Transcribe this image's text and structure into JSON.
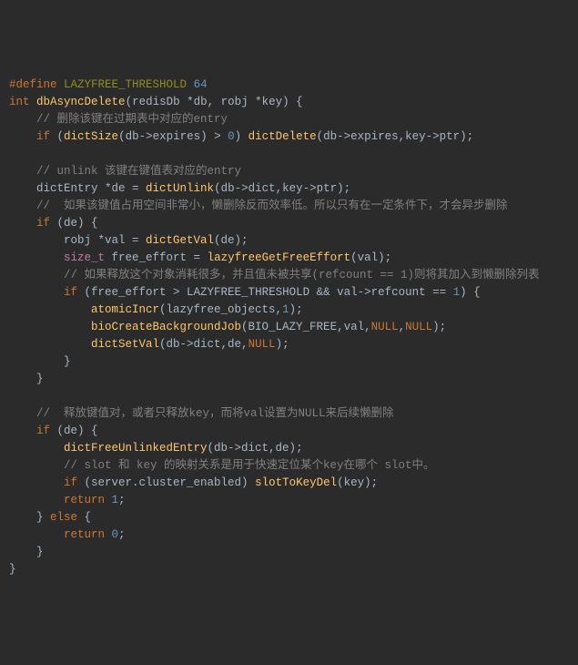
{
  "code": {
    "l01_define": "#define",
    "l01_macro": "LAZYFREE_THRESHOLD",
    "l01_val": "64",
    "l02_int": "int",
    "l02_fn": "dbAsyncDelete",
    "l02_sig": "(redisDb *db, robj *key) {",
    "l03": "// 删除该键在过期表中对应的entry",
    "l04_if": "if",
    "l04_a": " (",
    "l04_fn": "dictSize",
    "l04_b": "(db->expires) > ",
    "l04_zero": "0",
    "l04_c": ") ",
    "l04_fn2": "dictDelete",
    "l04_d": "(db->expires,key->ptr);",
    "l06": "// unlink 该键在键值表对应的entry",
    "l07_a": "dictEntry *de = ",
    "l07_fn": "dictUnlink",
    "l07_b": "(db->dict,key->ptr);",
    "l08": "//  如果该键值占用空间非常小，懒删除反而效率低。所以只有在一定条件下，才会异步删除",
    "l09_if": "if",
    "l09_a": " (de) {",
    "l10_a": "robj *val = ",
    "l10_fn": "dictGetVal",
    "l10_b": "(de);",
    "l11_type": "size_t",
    "l11_a": " free_effort = ",
    "l11_fn": "lazyfreeGetFreeEffort",
    "l11_b": "(val);",
    "l12": "// 如果释放这个对象消耗很多，并且值未被共享(refcount == 1)则将其加入到懒删除列表",
    "l13_if": "if",
    "l13_a": " (free_effort > LAZYFREE_THRESHOLD && val->refcount == ",
    "l13_one": "1",
    "l13_b": ") {",
    "l14_fn": "atomicIncr",
    "l14_a": "(lazyfree_objects,",
    "l14_one": "1",
    "l14_b": ");",
    "l15_fn": "bioCreateBackgroundJob",
    "l15_a": "(BIO_LAZY_FREE,val,",
    "l15_null1": "NULL",
    "l15_c": ",",
    "l15_null2": "NULL",
    "l15_b": ");",
    "l16_fn": "dictSetVal",
    "l16_a": "(db->dict,de,",
    "l16_null": "NULL",
    "l16_b": ");",
    "l17": "}",
    "l18": "}",
    "l20": "//  释放键值对，或者只释放key，而将val设置为NULL来后续懒删除",
    "l21_if": "if",
    "l21_a": " (de) {",
    "l22_fn": "dictFreeUnlinkedEntry",
    "l22_a": "(db->dict,de);",
    "l23": "// slot 和 key 的映射关系是用于快速定位某个key在哪个 slot中。",
    "l24_if": "if",
    "l24_a": " (server.cluster_enabled) ",
    "l24_fn": "slotToKeyDel",
    "l24_b": "(key);",
    "l25_ret": "return",
    "l25_val": " 1",
    "l25_b": ";",
    "l26_a": "} ",
    "l26_else": "else",
    "l26_b": " {",
    "l27_ret": "return",
    "l27_val": " 0",
    "l27_b": ";",
    "l28": "}",
    "l29": "}"
  }
}
